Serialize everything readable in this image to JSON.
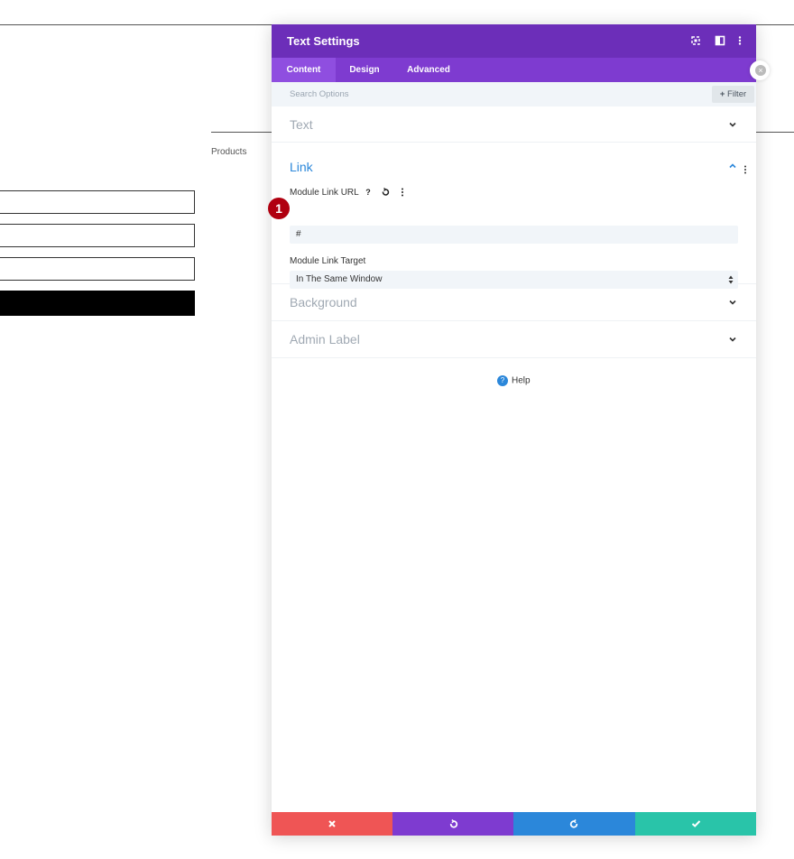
{
  "background_page": {
    "products_label": "Products"
  },
  "modal": {
    "title": "Text Settings",
    "header_icons": [
      "expand-icon",
      "split-view-icon",
      "more-options-icon"
    ],
    "tabs": [
      {
        "label": "Content",
        "active": true
      },
      {
        "label": "Design",
        "active": false
      },
      {
        "label": "Advanced",
        "active": false
      }
    ],
    "search": {
      "placeholder": "Search Options",
      "filter_label": "Filter"
    },
    "sections": {
      "text": {
        "title": "Text"
      },
      "link": {
        "title": "Link",
        "url_label": "Module Link URL",
        "url_value": "#",
        "target_label": "Module Link Target",
        "target_value": "In The Same Window"
      },
      "background": {
        "title": "Background"
      },
      "admin_label": {
        "title": "Admin Label"
      }
    },
    "help_label": "Help",
    "step_badge": "1",
    "footer": {
      "cancel_color": "#ef5555",
      "undo_color": "#7e3bd0",
      "redo_color": "#2b87da",
      "save_color": "#29c4a9"
    }
  },
  "colors": {
    "header": "#6c2eb9",
    "tabs": "#7e3bd0",
    "accent": "#2b87da"
  }
}
